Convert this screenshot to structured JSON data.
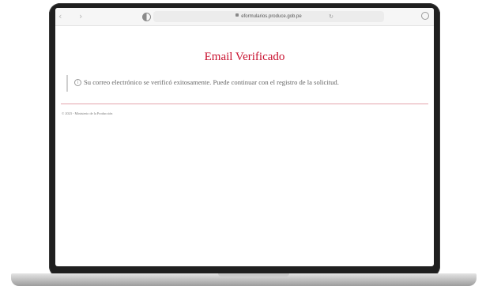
{
  "browser": {
    "url": "eformularios.produce.gob.pe",
    "back": "‹",
    "forward": "›",
    "reload": "↻"
  },
  "page": {
    "title": "Email Verificado",
    "message": "Su correo electrónico se verificó exitosamente. Puede continuar con el registro de la solicitud.",
    "info_glyph": "i",
    "footer": "© 2023 - Ministerio de la Producción"
  },
  "colors": {
    "title": "#c8102e",
    "divider": "#e3a3ab"
  },
  "icons": [
    "lock-icon",
    "reload-icon",
    "sidebar-toggle-icon",
    "download-icon",
    "info-icon"
  ]
}
